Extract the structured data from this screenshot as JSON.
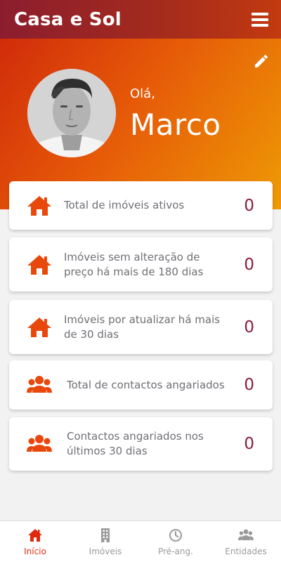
{
  "header": {
    "title": "Casa e Sol",
    "menu_icon": "hamburger-menu-icon"
  },
  "profile": {
    "greeting": "Olá,",
    "name": "Marco",
    "edit_icon": "pencil-icon"
  },
  "cards": [
    {
      "icon": "house-icon",
      "label": "Total de imóveis ativos",
      "value": "0"
    },
    {
      "icon": "house-icon",
      "label": "Imóveis sem alteração de preço há mais de 180 dias",
      "value": "0"
    },
    {
      "icon": "house-icon",
      "label": "Imóveis por atualizar há mais de 30 dias",
      "value": "0"
    },
    {
      "icon": "users-icon",
      "label": "Total de contactos angariados",
      "value": "0"
    },
    {
      "icon": "users-icon",
      "label": "Contactos angariados nos últimos 30 dias",
      "value": "0"
    }
  ],
  "nav": {
    "items": [
      {
        "label": "Início",
        "icon": "home-icon",
        "active": true
      },
      {
        "label": "Imóveis",
        "icon": "building-icon",
        "active": false
      },
      {
        "label": "Pré-ang.",
        "icon": "clock-icon",
        "active": false
      },
      {
        "label": "Entidades",
        "icon": "users-icon",
        "active": false
      }
    ]
  },
  "colors": {
    "header_gradient": [
      "#8b1d2e",
      "#c23a10"
    ],
    "hero_gradient": [
      "#d12c0a",
      "#ee9a05"
    ],
    "accent_icon": "#e8480c",
    "value_text": "#8a1c3a",
    "active_nav": "#e0280e"
  }
}
